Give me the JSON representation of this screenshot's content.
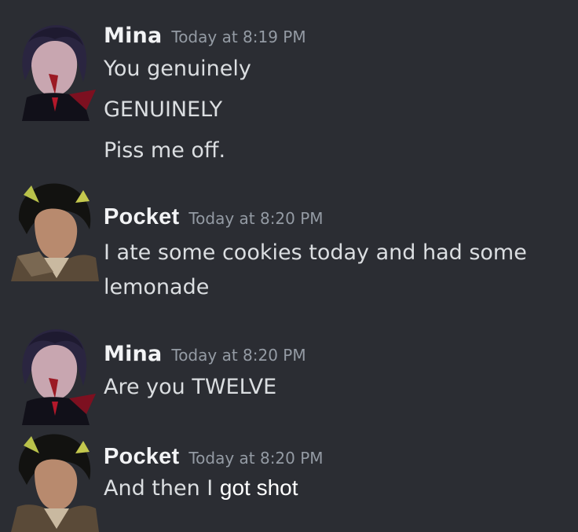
{
  "messages": [
    {
      "author": "Mina",
      "timestamp": "Today at 8:19 PM",
      "lines": [
        "You genuinely",
        "GENUINELY",
        "Piss me off."
      ]
    },
    {
      "author": "Pocket",
      "timestamp": "Today at 8:20 PM",
      "lines": [
        "I ate some cookies today and had some",
        "lemonade"
      ]
    },
    {
      "author": "Mina",
      "timestamp": "Today at 8:20 PM",
      "lines": [
        "Are you TWELVE"
      ]
    },
    {
      "author": "Pocket",
      "timestamp": "Today at 8:20 PM",
      "lines": [
        "And then I",
        "got shot"
      ]
    }
  ],
  "colors": {
    "background": "#2b2d33",
    "author_name": "#f2f3f5",
    "timestamp": "#949ba4",
    "message_text": "#dbdee1"
  }
}
